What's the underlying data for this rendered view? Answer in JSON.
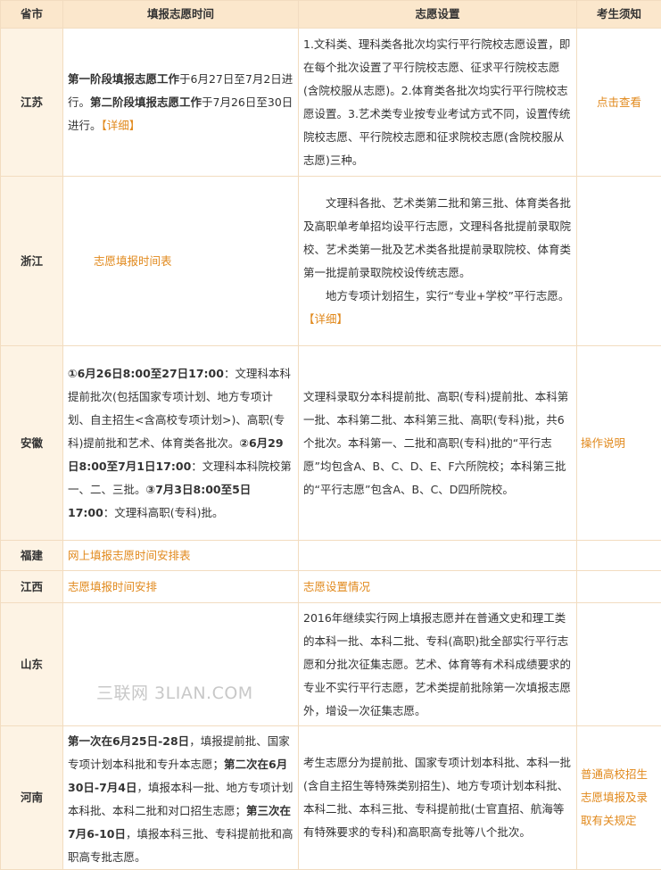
{
  "header": {
    "col1": "省市",
    "col2": "填报志愿时间",
    "col3": "志愿设置",
    "col4": "考生须知"
  },
  "jiangsu": {
    "province": "江苏",
    "time_b1": "第一阶段填报志愿工作",
    "time_t1": "于6月27日至7月2日进行。",
    "time_b2": "第二阶段填报志愿工作",
    "time_t2": "于7月26日至30日进行。",
    "time_link": "【详细】",
    "setting": "1.文科类、理科类各批次均实行平行院校志愿设置，即在每个批次设置了平行院校志愿、征求平行院校志愿(含院校服从志愿)。2.体育类各批次均实行平行院校志愿设置。3.艺术类专业按专业考试方式不同，设置传统院校志愿、平行院校志愿和征求院校志愿(含院校服从志愿)三种。",
    "notice_link": "点击查看"
  },
  "zhejiang": {
    "province": "浙江",
    "time_link": "志愿填报时间表",
    "setting_p1": "文理科各批、艺术类第二批和第三批、体育类各批及高职单考单招均设平行志愿，文理科各批提前录取院校、艺术类第一批及艺术类各批提前录取院校、体育类第一批提前录取院校设传统志愿。",
    "setting_p2": "地方专项计划招生，实行“专业+学校”平行志愿。",
    "setting_link": "【详细】"
  },
  "anhui": {
    "province": "安徽",
    "time_b1": "①6月26日8:00至27日17:00",
    "time_t1": "：文理科本科提前批次(包括国家专项计划、地方专项计划、自主招生<含高校专项计划>)、高职(专科)提前批和艺术、体育类各批次。",
    "time_b2": "②6月29日8:00至7月1日17:00",
    "time_t2": "：文理科本科院校第一、二、三批。",
    "time_b3": "③7月3日8:00至5日17:00",
    "time_t3": "：文理科高职(专科)批。",
    "setting": "文理科录取分本科提前批、高职(专科)提前批、本科第一批、本科第二批、本科第三批、高职(专科)批，共6个批次。本科第一、二批和高职(专科)批的“平行志愿”均包含A、B、C、D、E、F六所院校；本科第三批的“平行志愿”包含A、B、C、D四所院校。",
    "notice_link": "操作说明"
  },
  "fujian": {
    "province": "福建",
    "time_link": "网上填报志愿时间安排表"
  },
  "jiangxi": {
    "province": "江西",
    "time_link": "志愿填报时间安排",
    "setting_link": "志愿设置情况"
  },
  "shandong": {
    "province": "山东",
    "setting": "2016年继续实行网上填报志愿并在普通文史和理工类的本科一批、本科二批、专科(高职)批全部实行平行志愿和分批次征集志愿。艺术、体育等有术科成绩要求的专业不实行平行志愿，艺术类提前批除第一次填报志愿外，增设一次征集志愿。"
  },
  "henan": {
    "province": "河南",
    "time_b1": "第一次在6月25日-28日",
    "time_t1": "，填报提前批、国家专项计划本科批和专升本志愿；",
    "time_b2": "第二次在6月30日-7月4日",
    "time_t2": "，填报本科一批、地方专项计划本科批、本科二批和对口招生志愿；",
    "time_b3": "第三次在7月6-10日",
    "time_t3": "，填报本科三批、专科提前批和高职高专批志愿。",
    "setting": "考生志愿分为提前批、国家专项计划本科批、本科一批(含自主招生等特殊类别招生)、地方专项计划本科批、本科二批、本科三批、专科提前批(士官直招、航海等有特殊要求的专科)和高职高专批等八个批次。",
    "notice_link": "普通高校招生志愿填报及录取有关规定"
  },
  "watermark": "三联网 3LIAN.COM"
}
